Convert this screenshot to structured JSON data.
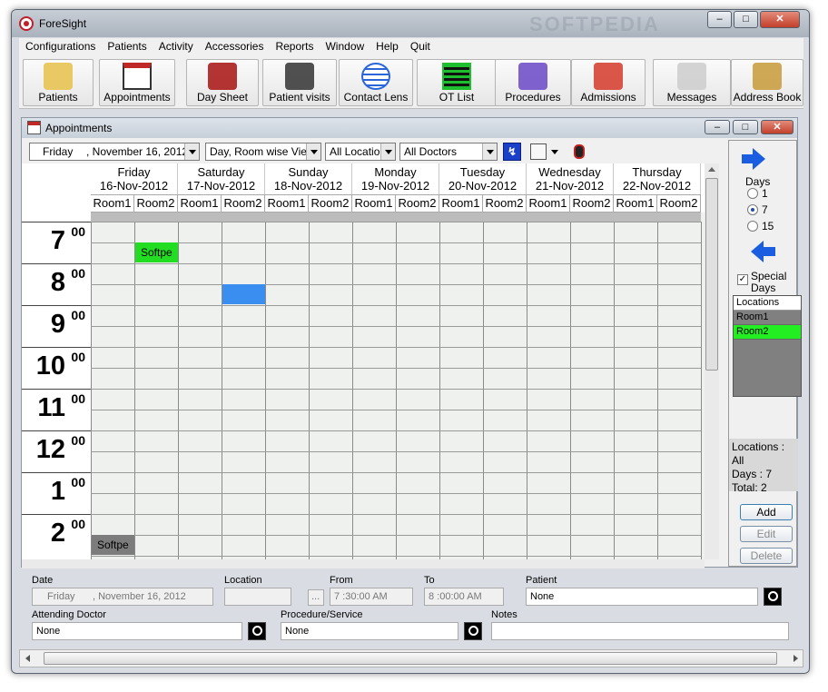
{
  "window": {
    "title": "ForeSight"
  },
  "menu": [
    "Configurations",
    "Patients",
    "Activity",
    "Accessories",
    "Reports",
    "Window",
    "Help",
    "Quit"
  ],
  "toolbar": [
    {
      "label": "Patients",
      "icon": "patients-icon"
    },
    {
      "label": "Appointments",
      "icon": "calendar-icon"
    },
    {
      "label": "Day Sheet",
      "icon": "day-sheet-icon"
    },
    {
      "label": "Patient visits",
      "icon": "patient-visits-icon"
    },
    {
      "label": "Contact Lens",
      "icon": "contact-lens-icon"
    },
    {
      "label": "OT List",
      "icon": "ot-list-icon"
    },
    {
      "label": "Procedures",
      "icon": "procedures-icon"
    },
    {
      "label": "Admissions",
      "icon": "admissions-icon"
    },
    {
      "label": "Messages",
      "icon": "messages-icon"
    },
    {
      "label": "Address Book",
      "icon": "address-book-icon"
    }
  ],
  "child": {
    "title": "Appointments"
  },
  "filters": {
    "date_day": "Friday",
    "date_value": ", November 16, 2012",
    "view": "Day, Room wise View",
    "location": "All Locatior",
    "doctors": "All Doctors"
  },
  "days": [
    {
      "name": "Friday",
      "date": "16-Nov-2012"
    },
    {
      "name": "Saturday",
      "date": "17-Nov-2012"
    },
    {
      "name": "Sunday",
      "date": "18-Nov-2012"
    },
    {
      "name": "Monday",
      "date": "19-Nov-2012"
    },
    {
      "name": "Tuesday",
      "date": "20-Nov-2012"
    },
    {
      "name": "Wednesday",
      "date": "21-Nov-2012"
    },
    {
      "name": "Thursday",
      "date": "22-Nov-2012"
    }
  ],
  "rooms": [
    "Room1",
    "Room2"
  ],
  "hours": [
    {
      "h": "7",
      "m": "00"
    },
    {
      "h": "8",
      "m": "00"
    },
    {
      "h": "9",
      "m": "00"
    },
    {
      "h": "10",
      "m": "00"
    },
    {
      "h": "11",
      "m": "00"
    },
    {
      "h": "12",
      "m": "00"
    },
    {
      "h": "1",
      "m": "00"
    },
    {
      "h": "2",
      "m": "00"
    }
  ],
  "appointments": [
    {
      "label": "Softpe",
      "color": "#22dd22"
    },
    {
      "label": "",
      "color": "#3a8ef0"
    },
    {
      "label": "Softpe",
      "color": "#7c7c7c"
    }
  ],
  "side": {
    "days_label": "Days",
    "day_options": [
      "1",
      "7",
      "15"
    ],
    "selected_days": "7",
    "special_days_label": "Special Days",
    "locations_header": "Locations",
    "locations": [
      {
        "name": "Room1",
        "color": "#808080"
      },
      {
        "name": "Room2",
        "color": "#22ee22"
      }
    ],
    "summary": {
      "locations": "Locations : All",
      "days": "Days : 7",
      "total": "Total:  2"
    },
    "add_label": "Add",
    "edit_label": "Edit",
    "delete_label": "Delete"
  },
  "form": {
    "date_label": "Date",
    "date_day": "Friday",
    "date_value": ", November 16, 2012",
    "location_label": "Location",
    "location_value": "",
    "from_label": "From",
    "from_value": "7 :30:00 AM",
    "to_label": "To",
    "to_value": "8 :00:00 AM",
    "patient_label": "Patient",
    "patient_value": "None",
    "doctor_label": "Attending Doctor",
    "doctor_value": "None",
    "procedure_label": "Procedure/Service",
    "procedure_value": "None",
    "notes_label": "Notes",
    "notes_value": "",
    "ellipsis": "..."
  },
  "watermark": "SOFTPEDIA"
}
